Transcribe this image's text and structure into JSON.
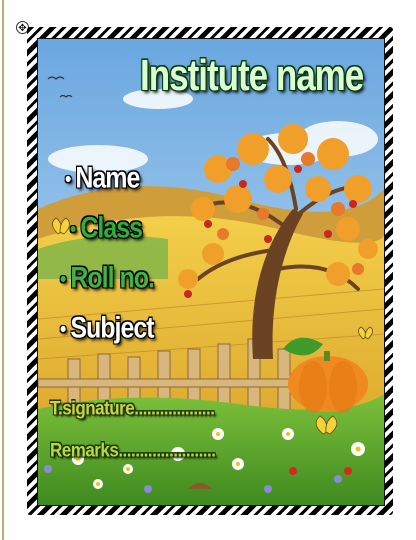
{
  "editor": {
    "move_handle_icon": "move-handle-icon"
  },
  "card": {
    "title": "Institute name",
    "fields": [
      {
        "bullet": "•",
        "label": "Name"
      },
      {
        "bullet": "•",
        "label": "Class"
      },
      {
        "bullet": "•",
        "label": "Roll no."
      },
      {
        "bullet": "•",
        "label": "Subject"
      }
    ],
    "signature": "T.signature...................",
    "remarks": "Remarks.......................",
    "scene": "autumn-tree-landscape",
    "colors": {
      "sky": "#7fb6e6",
      "hill": "#e0b23a",
      "grass": "#5aa02c",
      "title_fill": "#d9ffd2",
      "field_green": "#2fae3a"
    }
  }
}
